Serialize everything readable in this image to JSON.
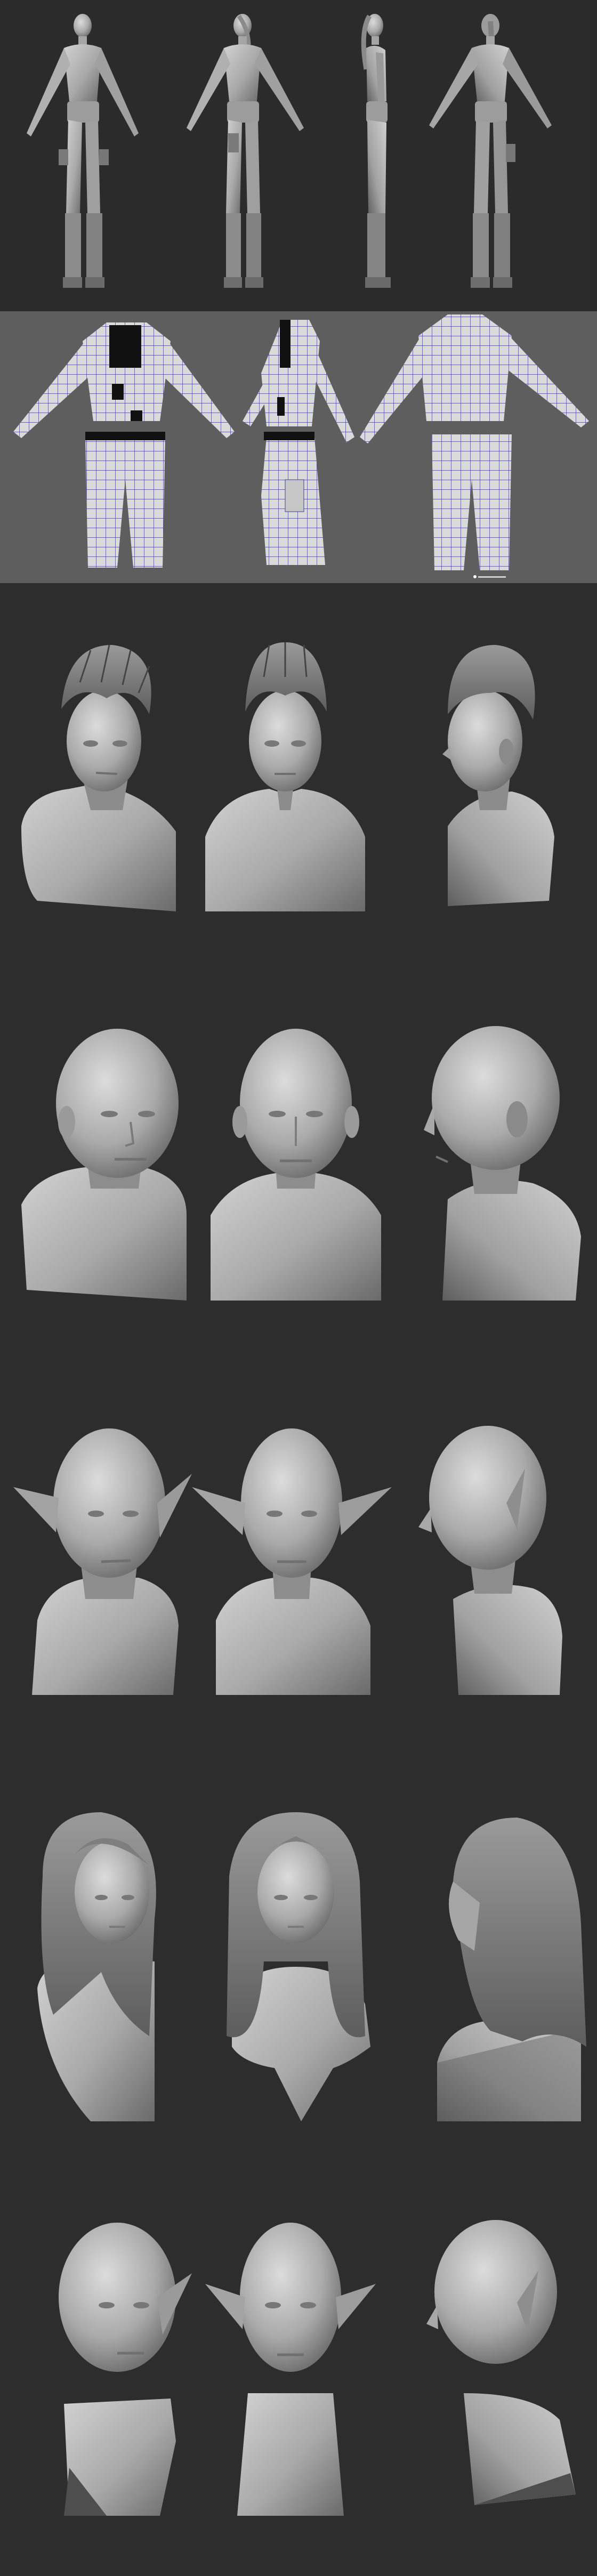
{
  "image": {
    "sections": [
      {
        "name": "full-body-turnaround",
        "views": [
          "front",
          "front-three-quarter",
          "side",
          "back"
        ]
      },
      {
        "name": "clothing-wireframe",
        "pieces": [
          "jacket-front",
          "jacket-side",
          "jacket-back",
          "pants-front",
          "pants-side",
          "pants-back"
        ]
      },
      {
        "name": "bust-short-hair",
        "views": [
          "three-quarter",
          "front",
          "side"
        ]
      },
      {
        "name": "bust-bald-male",
        "views": [
          "three-quarter",
          "front",
          "side"
        ]
      },
      {
        "name": "bust-elf-male",
        "views": [
          "three-quarter",
          "front",
          "side"
        ]
      },
      {
        "name": "bust-long-hair-female",
        "views": [
          "three-quarter",
          "front",
          "side"
        ]
      },
      {
        "name": "bust-elf-older",
        "views": [
          "three-quarter",
          "front",
          "side"
        ]
      }
    ],
    "colors": {
      "background": "#2d2d2d",
      "wireframe_background": "#5e5e5e",
      "clay": "#b8b8b8",
      "clay_shadow": "#6f6f6f",
      "wire_lines": "#3b3f8f"
    }
  }
}
